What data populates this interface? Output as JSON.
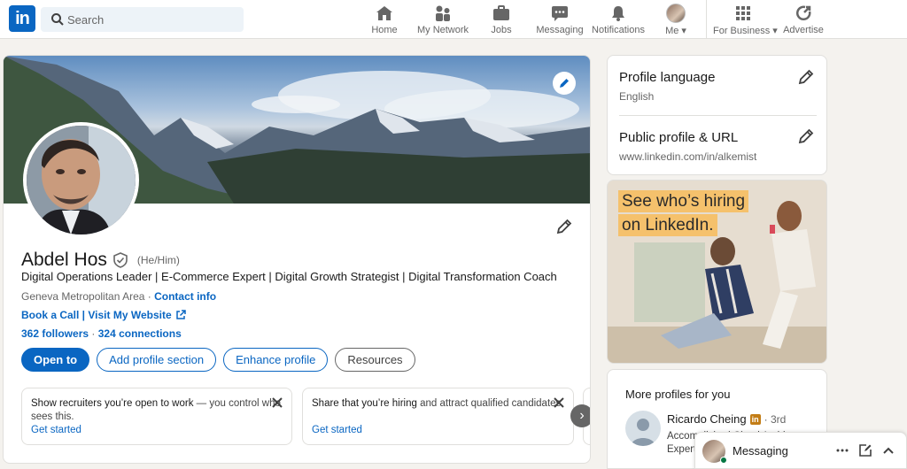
{
  "nav": {
    "search_placeholder": "Search",
    "items": [
      {
        "label": "Home",
        "icon": "home-icon"
      },
      {
        "label": "My Network",
        "icon": "network-icon"
      },
      {
        "label": "Jobs",
        "icon": "briefcase-icon"
      },
      {
        "label": "Messaging",
        "icon": "chat-icon"
      },
      {
        "label": "Notifications",
        "icon": "bell-icon"
      },
      {
        "label": "Me",
        "icon": "avatar"
      },
      {
        "label": "For Business",
        "icon": "grid-icon"
      },
      {
        "label": "Advertise",
        "icon": "advertise-icon"
      }
    ]
  },
  "profile": {
    "name": "Abdel Hos",
    "pronouns": "(He/Him)",
    "headline": "Digital Operations Leader | E-Commerce Expert | Digital Growth Strategist | Digital Transformation Coach",
    "location": "Geneva Metropolitan Area",
    "location_sep": " · ",
    "contact_info": "Contact info",
    "website": "Book a Call | Visit My Website",
    "followers": "362 followers",
    "connections": "324 connections",
    "buttons": {
      "open_to": "Open to",
      "add_section": "Add profile section",
      "enhance": "Enhance profile",
      "resources": "Resources"
    },
    "tips": [
      {
        "bold": "Show recruiters you’re open to work",
        "rest": " — you control who sees this.",
        "cta": "Get started"
      },
      {
        "bold": "Share that you’re hiring",
        "rest": " and attract qualified candidates.",
        "cta": "Get started"
      }
    ]
  },
  "sidebar": {
    "profile_language": {
      "title": "Profile language",
      "value": "English"
    },
    "public_profile": {
      "title": "Public profile & URL",
      "value": "www.linkedin.com/in/alkemist"
    },
    "ad": {
      "line1": "See who’s hiring",
      "line2": "on LinkedIn."
    },
    "more_profiles": {
      "title": "More profiles for you",
      "people": [
        {
          "name": "Ricardo Cheing",
          "degree": "· 3rd",
          "headline": "Accomplished Cloud Architect Expert"
        }
      ]
    }
  },
  "messaging": {
    "label": "Messaging"
  },
  "colors": {
    "brand": "#0a66c2",
    "background": "#f4f2ee",
    "premium_badge": "#c37d16"
  }
}
